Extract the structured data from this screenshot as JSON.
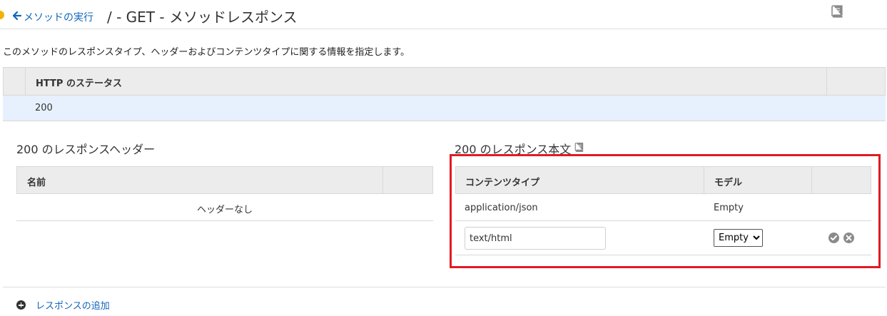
{
  "header": {
    "back_link": "メソッドの実行",
    "title": "/ - GET - メソッドレスポンス"
  },
  "description": "このメソッドのレスポンスタイプ、ヘッダーおよびコンテンツタイプに関する情報を指定します。",
  "status_table": {
    "column": "HTTP のステータス",
    "rows": [
      "200"
    ]
  },
  "response_headers": {
    "title": "200 のレスポンスヘッダー",
    "column_name": "名前",
    "empty_text": "ヘッダーなし"
  },
  "response_body": {
    "title": "200 のレスポンス本文",
    "columns": {
      "content_type": "コンテンツタイプ",
      "model": "モデル"
    },
    "rows": [
      {
        "content_type": "application/json",
        "model": "Empty"
      }
    ],
    "new_row": {
      "content_type_value": "text/html",
      "model_options": [
        "Empty"
      ],
      "model_selected": "Empty"
    }
  },
  "add_response_label": "レスポンスの追加",
  "colors": {
    "link": "#1166bb",
    "highlight_border": "#e01b24",
    "selected_row": "#e6f1fd",
    "table_header": "#ececec"
  },
  "icons": [
    "arrow-left-icon",
    "book-icon",
    "check-circle-icon",
    "close-circle-icon",
    "plus-circle-icon"
  ]
}
